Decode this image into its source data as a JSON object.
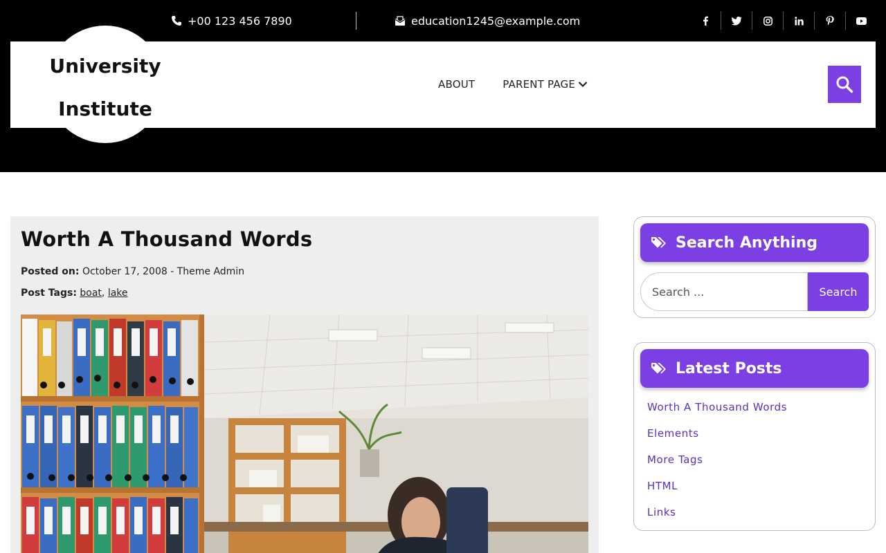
{
  "topbar": {
    "phone": "+00 123 456 7890",
    "email": "education1245@example.com",
    "social_icons": [
      "facebook-icon",
      "twitter-icon",
      "instagram-icon",
      "linkedin-icon",
      "pinterest-icon",
      "youtube-icon"
    ]
  },
  "site": {
    "title_line1": "University",
    "title_line2": "Institute"
  },
  "nav": {
    "items": [
      {
        "label": "ABOUT"
      },
      {
        "label": "PARENT PAGE"
      }
    ]
  },
  "post": {
    "title": "Worth A Thousand Words",
    "posted_on_label": "Posted on:",
    "posted_on_value": "October 17, 2008 - Theme Admin",
    "tags_label": "Post Tags:",
    "tags": [
      "boat",
      "lake"
    ],
    "tag_separator": ","
  },
  "sidebar": {
    "search_widget": {
      "title": "Search Anything",
      "placeholder": "Search ...",
      "button": "Search"
    },
    "latest_widget": {
      "title": "Latest Posts",
      "items": [
        "Worth A Thousand Words",
        "Elements",
        "More Tags",
        "HTML",
        "Links"
      ]
    }
  },
  "colors": {
    "accent": "#7b3fe4",
    "topbar_bg": "#000000",
    "article_bg": "#eeeeee"
  }
}
